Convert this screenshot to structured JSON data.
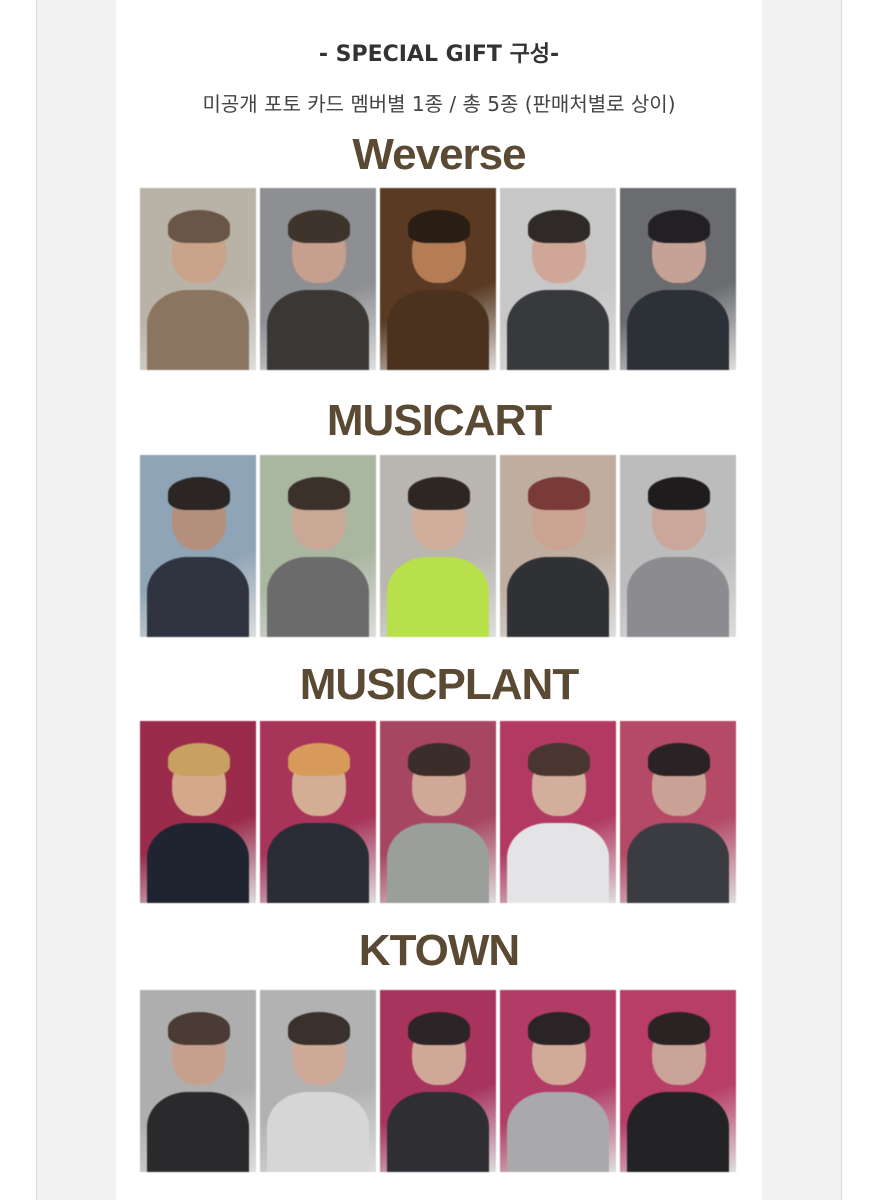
{
  "header": {
    "title": "- SPECIAL GIFT 구성-",
    "subtitle": "미공개 포토 카드 멤버별 1종 / 총 5종 (판매처별로 상이)"
  },
  "sections": [
    {
      "name": "Weverse",
      "cards": [
        {
          "bg": "#b9b2a6",
          "face": "#c9a38a",
          "hair": "#6a5646",
          "body": "#8a7560"
        },
        {
          "bg": "#8e8f93",
          "face": "#c69f8e",
          "hair": "#3f342c",
          "body": "#3a3734"
        },
        {
          "bg": "#5a3a22",
          "face": "#b57d56",
          "hair": "#2a1d14",
          "body": "#4a321f"
        },
        {
          "bg": "#c7c7c7",
          "face": "#cfa697",
          "hair": "#2f2a28",
          "body": "#37393d"
        },
        {
          "bg": "#6a6c70",
          "face": "#c6a196",
          "hair": "#222022",
          "body": "#2c3138"
        }
      ]
    },
    {
      "name": "MUSICART",
      "cards": [
        {
          "bg": "#8fa4b6",
          "face": "#b48f7c",
          "hair": "#2b2624",
          "body": "#2f3440"
        },
        {
          "bg": "#a9b6a0",
          "face": "#c9a896",
          "hair": "#3b302a",
          "body": "#6b6b6b"
        },
        {
          "bg": "#b9b5b0",
          "face": "#d1ad9c",
          "hair": "#2e2622",
          "body": "#b8e04a"
        },
        {
          "bg": "#bfaea0",
          "face": "#caa392",
          "hair": "#7a3a38",
          "body": "#2f3135"
        },
        {
          "bg": "#bcbcbc",
          "face": "#caa79a",
          "hair": "#1e1c1c",
          "body": "#8c8c90"
        }
      ]
    },
    {
      "name": "MUSICPLANT",
      "cards": [
        {
          "bg": "#9a2b4a",
          "face": "#d4a88a",
          "hair": "#c8a060",
          "body": "#1f2430"
        },
        {
          "bg": "#a8345a",
          "face": "#d4ad95",
          "hair": "#d89a5a",
          "body": "#2a2d36"
        },
        {
          "bg": "#a64660",
          "face": "#cfa897",
          "hair": "#3b2e2a",
          "body": "#9a9f9c"
        },
        {
          "bg": "#b23a62",
          "face": "#d4ae9c",
          "hair": "#4a3630",
          "body": "#e4e4e6"
        },
        {
          "bg": "#b44a66",
          "face": "#caa295",
          "hair": "#2a2224",
          "body": "#3a3c42"
        }
      ]
    },
    {
      "name": "KTOWN",
      "cards": [
        {
          "bg": "#aeaeae",
          "face": "#c7a08d",
          "hair": "#4a3c34",
          "body": "#2a2a2c"
        },
        {
          "bg": "#b2b2b2",
          "face": "#cfaa98",
          "hair": "#3a302c",
          "body": "#d6d6d6"
        },
        {
          "bg": "#a8345e",
          "face": "#cfa898",
          "hair": "#2c2426",
          "body": "#2f2f33"
        },
        {
          "bg": "#b23c66",
          "face": "#d1aa99",
          "hair": "#2b2426",
          "body": "#a9a9ac"
        },
        {
          "bg": "#b83e68",
          "face": "#caa397",
          "hair": "#2b2224",
          "body": "#232326"
        }
      ]
    }
  ]
}
